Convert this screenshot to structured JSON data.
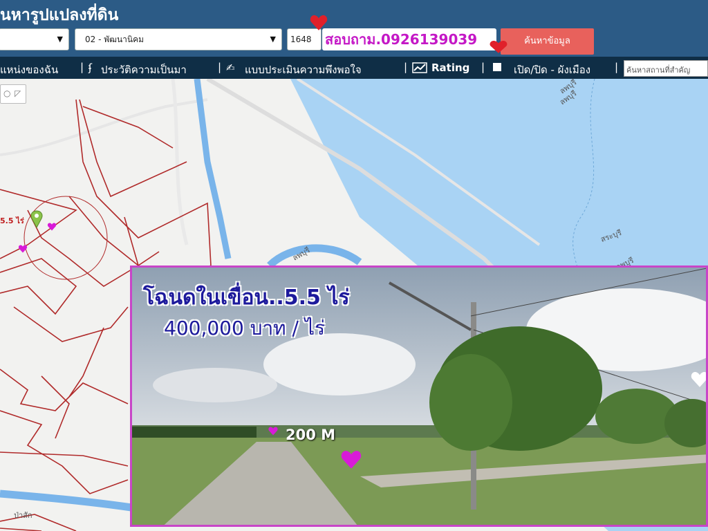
{
  "header": {
    "title": "นหารูปแปลงที่ดิน",
    "district_select": "02 - พัฒนานิคม",
    "parcel_input": "1648",
    "contact_text": "สอบถาม.0926139039",
    "search_button": "ค้นหาข้อมูล"
  },
  "toolbar": {
    "items": [
      "แหน่งของฉัน",
      "ประวัติความเป็นมา",
      "แบบประเมินความพึงพอใจ",
      "Rating",
      "เปิด/ปิด - ผังเมือง"
    ],
    "search_placeholder": "ค้นหาสถานที่สำคัญ"
  },
  "map": {
    "plot_label": "5.5 ไร่",
    "place_labels": [
      "ลพบุรี",
      "ลพบุรี",
      "สระบุรี",
      "ลพบุรี",
      "ลพบุรี",
      "ป่าสัก"
    ]
  },
  "overlay": {
    "title": "โฉนดในเขื่อน..5.5 ไร่",
    "price": "400,000 บาท / ไร่",
    "distance": "200 M"
  },
  "colors": {
    "header_bg": "#2c5b86",
    "toolbar_bg": "#0f2e46",
    "search_button": "#e8615c",
    "contact_text": "#c418c6",
    "overlay_text": "#1d1a9c",
    "overlay_border": "#c845c8",
    "parcel_lines": "#b02a2a"
  },
  "icons": [
    "pin-icon",
    "history-icon",
    "survey-icon",
    "rating-icon",
    "checkbox-icon",
    "heart-icon"
  ]
}
